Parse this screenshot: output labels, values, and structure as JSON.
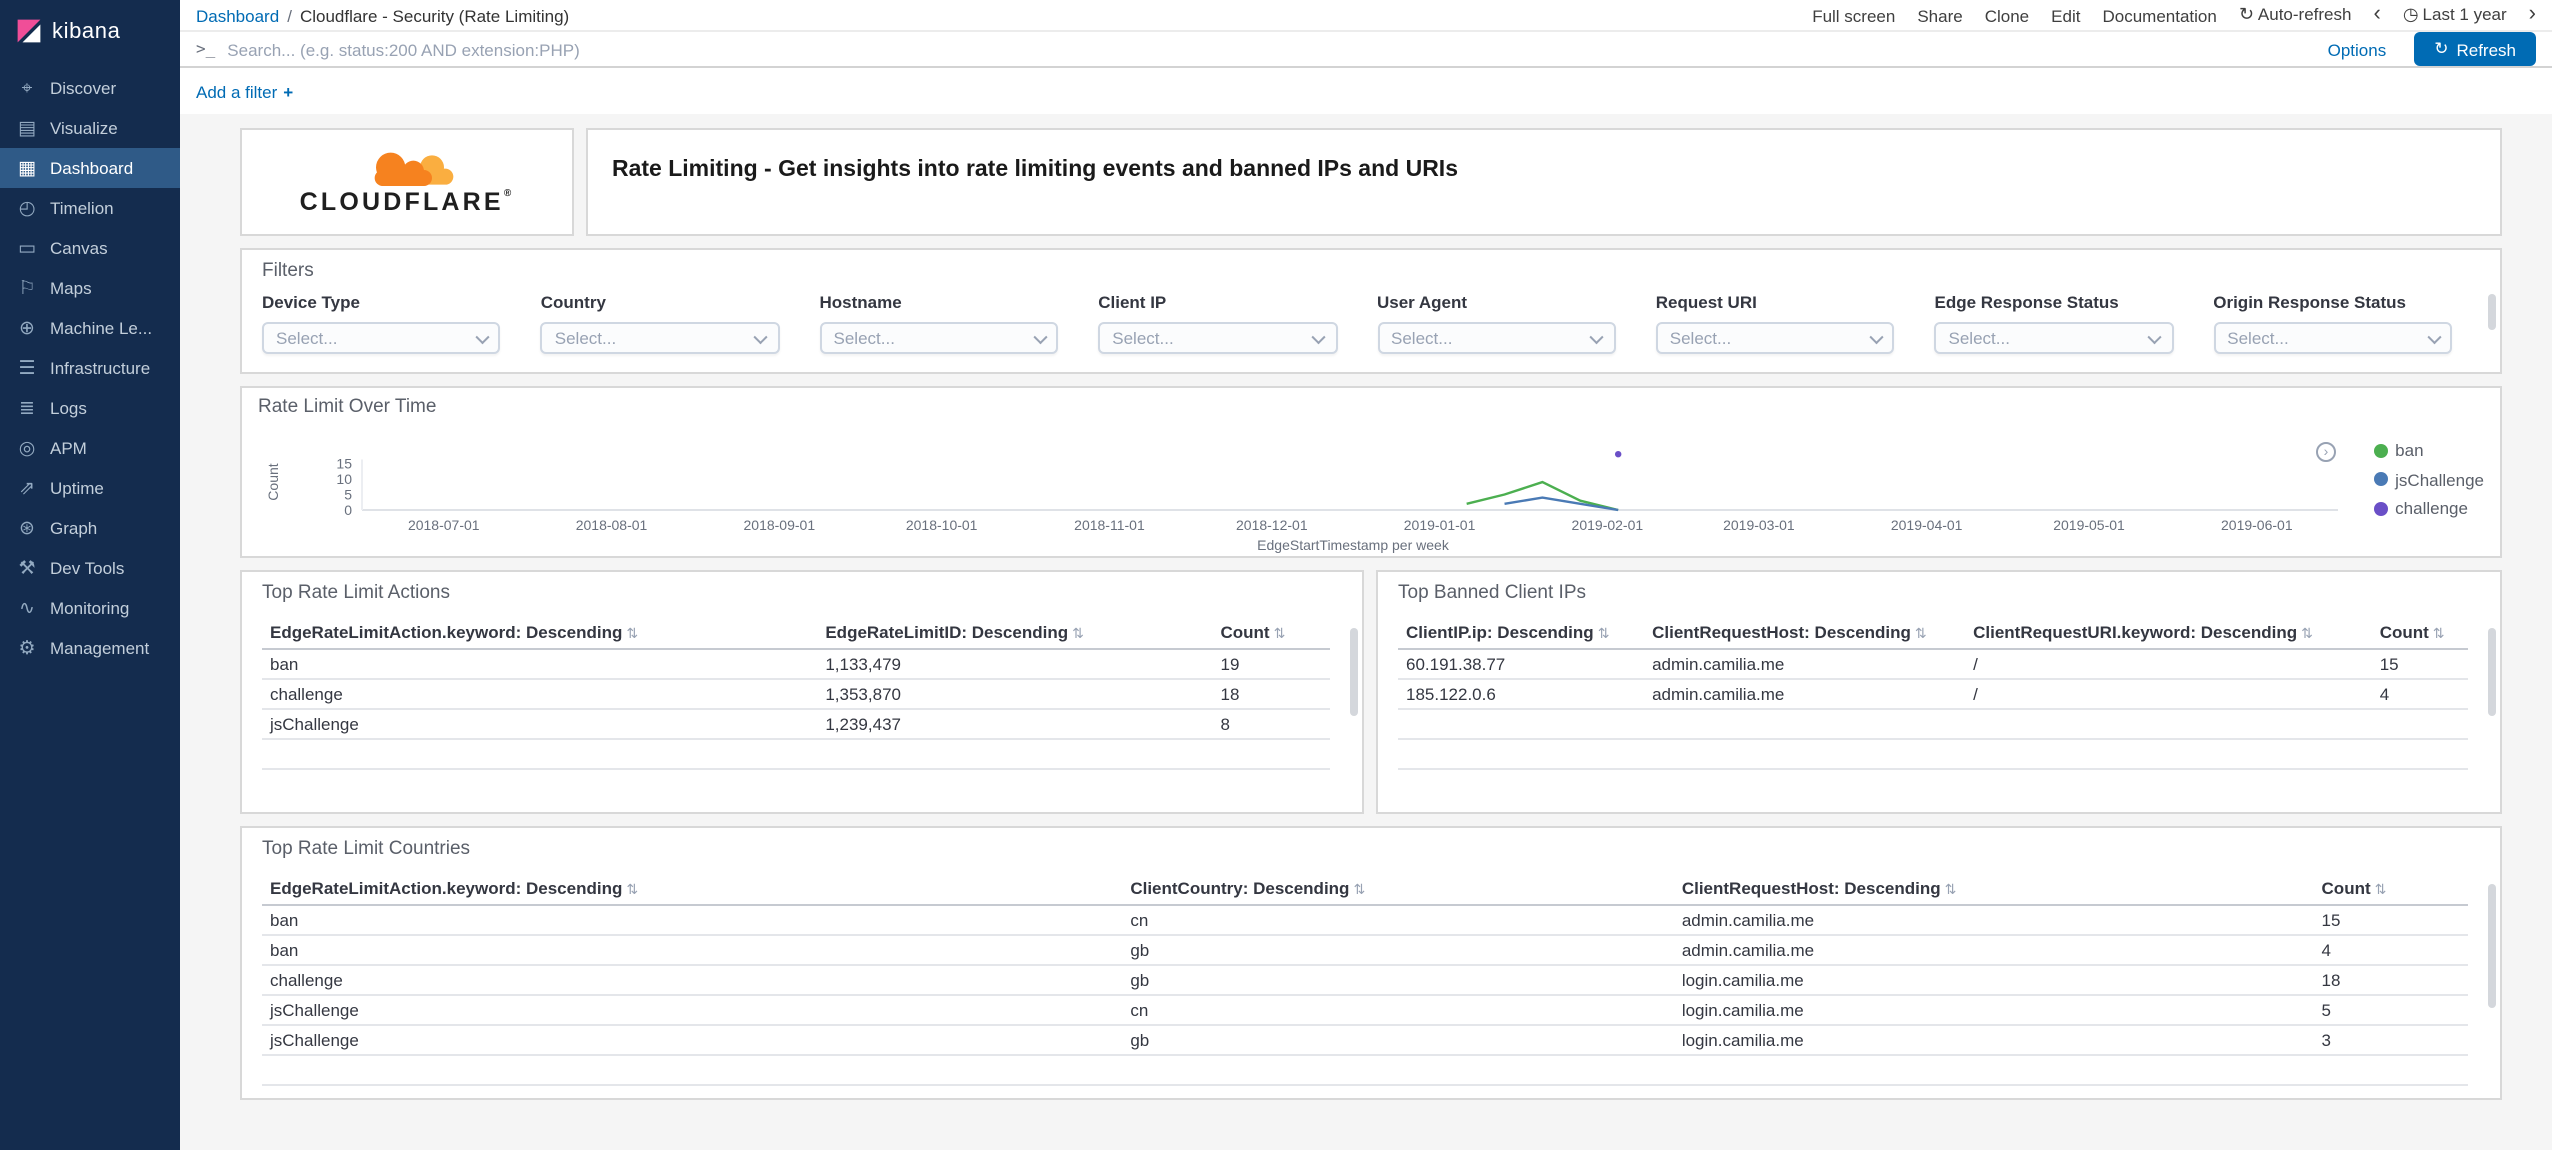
{
  "app": {
    "brand": "kibana"
  },
  "ui": {
    "sort_glyph": "⇅",
    "legend_toggle_glyph": "›"
  },
  "sidebar": {
    "items": [
      {
        "label": "Discover",
        "icon": "compass-icon",
        "glyph": "⌖"
      },
      {
        "label": "Visualize",
        "icon": "bar-chart-icon",
        "glyph": "▤"
      },
      {
        "label": "Dashboard",
        "icon": "dashboard-grid-icon",
        "glyph": "▦",
        "active": true
      },
      {
        "label": "Timelion",
        "icon": "time-chart-icon",
        "glyph": "◴"
      },
      {
        "label": "Canvas",
        "icon": "canvas-icon",
        "glyph": "▭"
      },
      {
        "label": "Maps",
        "icon": "map-pin-icon",
        "glyph": "⚐"
      },
      {
        "label": "Machine Le...",
        "icon": "machine-learning-icon",
        "glyph": "⊕"
      },
      {
        "label": "Infrastructure",
        "icon": "infrastructure-icon",
        "glyph": "☰"
      },
      {
        "label": "Logs",
        "icon": "logs-icon",
        "glyph": "≣"
      },
      {
        "label": "APM",
        "icon": "apm-icon",
        "glyph": "◎"
      },
      {
        "label": "Uptime",
        "icon": "uptime-icon",
        "glyph": "⇗"
      },
      {
        "label": "Graph",
        "icon": "graph-icon",
        "glyph": "⊛"
      },
      {
        "label": "Dev Tools",
        "icon": "wrench-icon",
        "glyph": "⚒"
      },
      {
        "label": "Monitoring",
        "icon": "pulse-icon",
        "glyph": "∿"
      },
      {
        "label": "Management",
        "icon": "gear-icon",
        "glyph": "⚙"
      }
    ]
  },
  "toolbar": {
    "breadcrumb": {
      "link": "Dashboard",
      "separator": "/",
      "current": "Cloudflare - Security (Rate Limiting)"
    },
    "menu": [
      "Full screen",
      "Share",
      "Clone",
      "Edit",
      "Documentation"
    ],
    "auto_refresh": {
      "icon": "refresh-icon",
      "glyph": "↻",
      "label": "Auto-refresh"
    },
    "time_back_glyph": "‹",
    "time_forward_glyph": "›",
    "time_picker": {
      "icon": "clock-icon",
      "glyph": "◷",
      "label": "Last 1 year"
    }
  },
  "search_bar": {
    "prompt_glyph": ">_",
    "placeholder": "Search... (e.g. status:200 AND extension:PHP)",
    "options_label": "Options",
    "refresh": {
      "icon": "refresh-icon",
      "glyph": "↻",
      "label": "Refresh"
    }
  },
  "filter_row": {
    "add_filter_label": "Add a filter",
    "plus_glyph": "+"
  },
  "panels": {
    "branding": {
      "brand_name": "CLOUDFLARE",
      "registered_mark": "®"
    },
    "markdown": {
      "text": "Rate Limiting - Get insights into rate limiting events and banned IPs and URIs"
    },
    "filters": {
      "title": "Filters",
      "fields": [
        {
          "label": "Device Type",
          "value": "Select..."
        },
        {
          "label": "Country",
          "value": "Select..."
        },
        {
          "label": "Hostname",
          "value": "Select..."
        },
        {
          "label": "Client IP",
          "value": "Select..."
        },
        {
          "label": "User Agent",
          "value": "Select..."
        },
        {
          "label": "Request URI",
          "value": "Select..."
        },
        {
          "label": "Edge Response Status",
          "value": "Select..."
        },
        {
          "label": "Origin Response Status",
          "value": "Select..."
        }
      ]
    },
    "top_rate_limit_actions": {
      "title": "Top Rate Limit Actions",
      "columns": [
        "EdgeRateLimitAction.keyword: Descending",
        "EdgeRateLimitID: Descending",
        "Count"
      ],
      "rows": [
        [
          "ban",
          "1,133,479",
          "19"
        ],
        [
          "challenge",
          "1,353,870",
          "18"
        ],
        [
          "jsChallenge",
          "1,239,437",
          "8"
        ]
      ]
    },
    "top_banned_client_ips": {
      "title": "Top Banned Client IPs",
      "columns": [
        "ClientIP.ip: Descending",
        "ClientRequestHost: Descending",
        "ClientRequestURI.keyword: Descending",
        "Count"
      ],
      "rows": [
        [
          "60.191.38.77",
          "admin.camilia.me",
          "/",
          "15"
        ],
        [
          "185.122.0.6",
          "admin.camilia.me",
          "/",
          "4"
        ]
      ]
    },
    "top_rate_limit_countries": {
      "title": "Top Rate Limit Countries",
      "columns": [
        "EdgeRateLimitAction.keyword: Descending",
        "ClientCountry: Descending",
        "ClientRequestHost: Descending",
        "Count"
      ],
      "rows": [
        [
          "ban",
          "cn",
          "admin.camilia.me",
          "15"
        ],
        [
          "ban",
          "gb",
          "admin.camilia.me",
          "4"
        ],
        [
          "challenge",
          "gb",
          "login.camilia.me",
          "18"
        ],
        [
          "jsChallenge",
          "cn",
          "login.camilia.me",
          "5"
        ],
        [
          "jsChallenge",
          "gb",
          "login.camilia.me",
          "3"
        ]
      ]
    }
  },
  "chart_data": {
    "type": "line",
    "title": "Rate Limit Over Time",
    "xlabel": "EdgeStartTimestamp per week",
    "ylabel": "Count",
    "ylim": [
      0,
      15
    ],
    "y_ticks": [
      0,
      5,
      10,
      15
    ],
    "x_domain": [
      "2018-06-17",
      "2019-06-16"
    ],
    "x_ticks": [
      "2018-07-01",
      "2018-08-01",
      "2018-09-01",
      "2018-10-01",
      "2018-11-01",
      "2018-12-01",
      "2019-01-01",
      "2019-02-01",
      "2019-03-01",
      "2019-04-01",
      "2019-05-01",
      "2019-06-01"
    ],
    "grid": false,
    "legend_position": "right",
    "series": [
      {
        "name": "ban",
        "color": "#4caf50",
        "points": [
          [
            "2019-01-06",
            2
          ],
          [
            "2019-01-13",
            5
          ],
          [
            "2019-01-20",
            9
          ],
          [
            "2019-01-27",
            3
          ],
          [
            "2019-02-03",
            0
          ]
        ]
      },
      {
        "name": "jsChallenge",
        "color": "#4a7ab5",
        "points": [
          [
            "2019-01-13",
            2
          ],
          [
            "2019-01-20",
            4
          ],
          [
            "2019-01-27",
            2
          ],
          [
            "2019-02-03",
            0
          ]
        ]
      },
      {
        "name": "challenge",
        "color": "#6a4fc7",
        "points": [
          [
            "2019-02-03",
            18
          ]
        ]
      }
    ]
  }
}
